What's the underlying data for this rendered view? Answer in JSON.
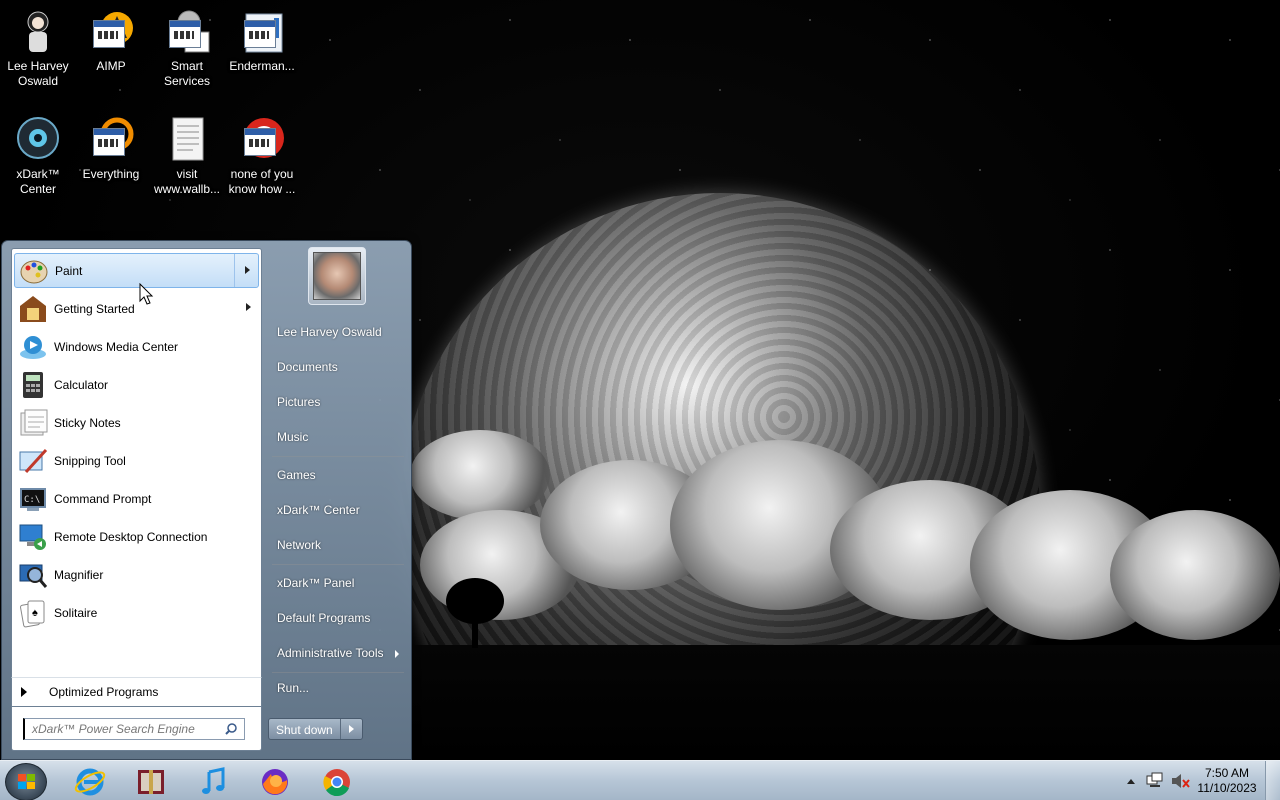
{
  "desktop": {
    "icons": [
      {
        "label_line1": "Lee Harvey",
        "label_line2": "Oswald",
        "icon": "user-folder-icon"
      },
      {
        "label_line1": "AIMP",
        "label_line2": "",
        "icon": "aimp-icon"
      },
      {
        "label_line1": "Smart",
        "label_line2": "Services",
        "icon": "smart-services-icon"
      },
      {
        "label_line1": "Enderman...",
        "label_line2": "",
        "icon": "enderman-icon"
      },
      {
        "label_line1": "xDark™",
        "label_line2": "Center",
        "icon": "xdark-center-icon"
      },
      {
        "label_line1": "Everything",
        "label_line2": "",
        "icon": "everything-icon"
      },
      {
        "label_line1": "visit",
        "label_line2": "www.wallb...",
        "icon": "text-file-icon"
      },
      {
        "label_line1": "none of you",
        "label_line2": "know how ...",
        "icon": "none-of-you-icon"
      }
    ]
  },
  "start_menu": {
    "programs": [
      {
        "label": "Paint",
        "icon": "paint-icon",
        "has_submenu": true
      },
      {
        "label": "Getting Started",
        "icon": "getting-started-icon",
        "has_submenu": true
      },
      {
        "label": "Windows Media Center",
        "icon": "media-center-icon",
        "has_submenu": false
      },
      {
        "label": "Calculator",
        "icon": "calculator-icon",
        "has_submenu": false
      },
      {
        "label": "Sticky Notes",
        "icon": "sticky-notes-icon",
        "has_submenu": false
      },
      {
        "label": "Snipping Tool",
        "icon": "snipping-tool-icon",
        "has_submenu": false
      },
      {
        "label": "Command Prompt",
        "icon": "command-prompt-icon",
        "has_submenu": false
      },
      {
        "label": "Remote Desktop Connection",
        "icon": "remote-desktop-icon",
        "has_submenu": false
      },
      {
        "label": "Magnifier",
        "icon": "magnifier-icon",
        "has_submenu": false
      },
      {
        "label": "Solitaire",
        "icon": "solitaire-icon",
        "has_submenu": false
      }
    ],
    "all_programs_label": "Optimized Programs",
    "search_placeholder": "xDark™ Power Search Engine",
    "right_links": [
      {
        "label": "Lee Harvey Oswald",
        "has_submenu": false
      },
      {
        "label": "Documents",
        "has_submenu": false
      },
      {
        "label": "Pictures",
        "has_submenu": false
      },
      {
        "label": "Music",
        "has_submenu": false
      },
      {
        "label": "Games",
        "has_submenu": false
      },
      {
        "label": "xDark™ Center",
        "has_submenu": false
      },
      {
        "label": "Network",
        "has_submenu": false
      },
      {
        "label": "xDark™ Panel",
        "has_submenu": false
      },
      {
        "label": "Default Programs",
        "has_submenu": false
      },
      {
        "label": "Administrative Tools",
        "has_submenu": true
      },
      {
        "label": "Run...",
        "has_submenu": false
      }
    ],
    "shutdown_label": "Shut down"
  },
  "taskbar": {
    "pinned": [
      {
        "icon": "internet-explorer-icon"
      },
      {
        "icon": "archive-icon"
      },
      {
        "icon": "music-player-icon"
      },
      {
        "icon": "firefox-icon"
      },
      {
        "icon": "chrome-icon"
      }
    ],
    "clock_time": "7:50 AM",
    "clock_date": "11/10/2023"
  }
}
